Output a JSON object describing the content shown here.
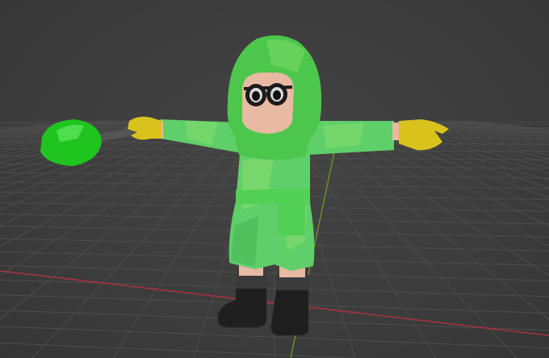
{
  "viewport": {
    "background_color": "#3d3d3d",
    "grid_color": "#4d4d4d",
    "x_axis_color": "#a9333f",
    "y_axis_color": "#7a9a24"
  },
  "model": {
    "hood_color": "#4cc74c",
    "robe_color": "#5fcf6a",
    "robe_highlight_color": "#8adf6e",
    "belt_color": "#52cf55",
    "skin_color": "#e8b9a3",
    "glasses_color": "#1b1b1b",
    "glove_color": "#d9c21c",
    "boot_color": "#1f1f1f",
    "boot_cuff_color": "#3a3a3a",
    "staff_color": "#555555",
    "gem_color": "#1fc41f"
  }
}
